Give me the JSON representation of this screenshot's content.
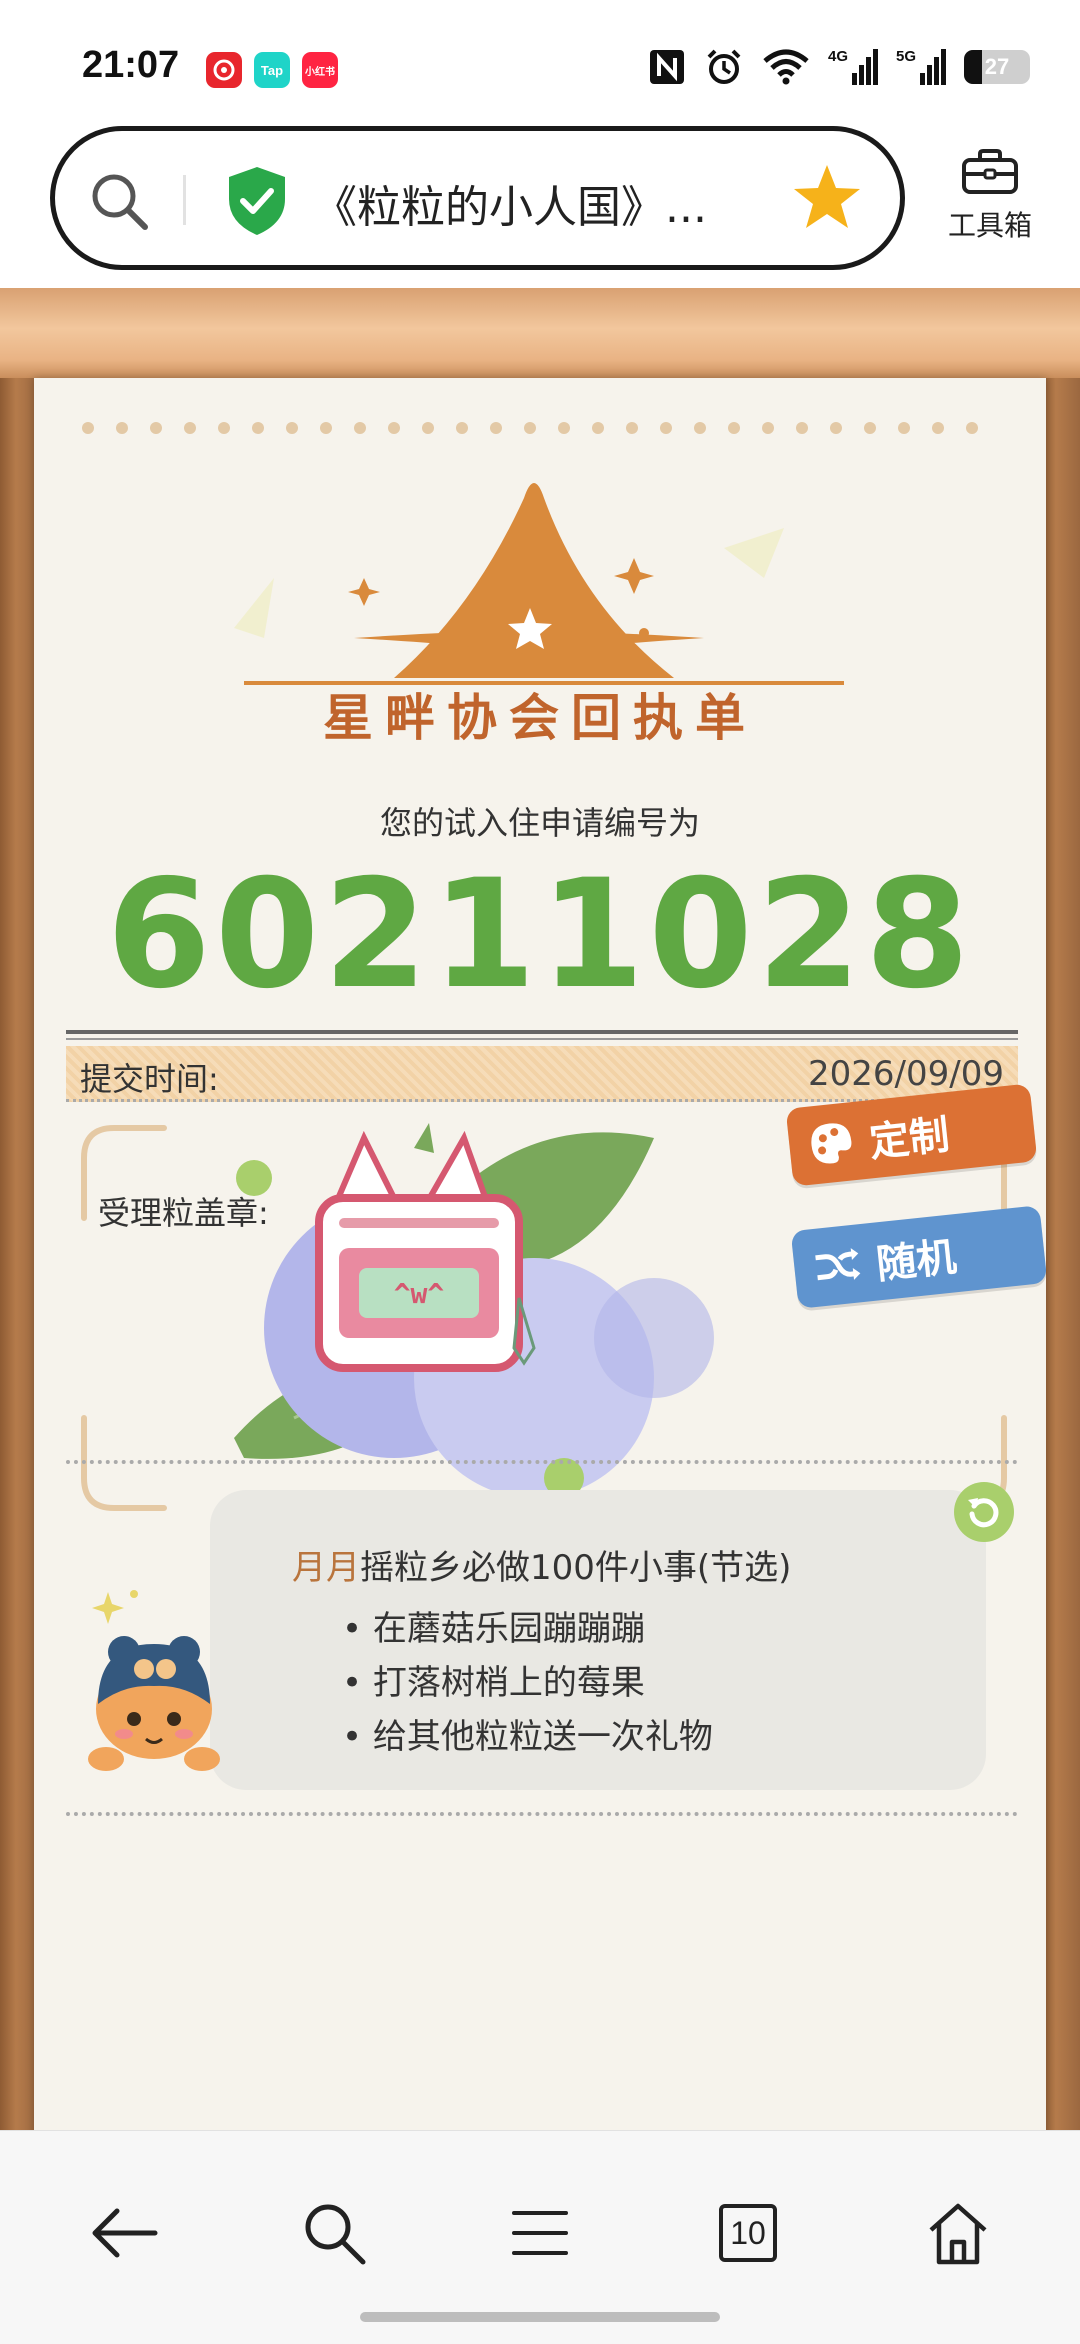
{
  "status_bar": {
    "time": "21:07",
    "apps": [
      {
        "name": "app-icon-red",
        "label": "",
        "color": "#e8262d"
      },
      {
        "name": "tap-icon",
        "label": "Tap",
        "color": "#1fd4c8"
      },
      {
        "name": "xiaohongshu-icon",
        "label": "小红书",
        "color": "#ff2442"
      }
    ],
    "network_4g": "4G",
    "network_5g": "5G",
    "battery_level": "27"
  },
  "address_bar": {
    "title": "《粒粒的小人国》...",
    "secure": true,
    "bookmarked": true
  },
  "toolbox": {
    "label": "工具箱"
  },
  "receipt": {
    "logo_title": "星畔协会回执单",
    "subtitle": "您的试入住申请编号为",
    "application_number": "60211028",
    "submit_label": "提交时间:",
    "submit_date": "2026/09/09",
    "stamp_label": "受理粒盖章:",
    "stamp_face": "^w^",
    "btn_custom": "定制",
    "btn_random": "随机"
  },
  "todo": {
    "author": "月月",
    "title_rest": "摇粒乡必做100件小事(节选)",
    "items": [
      "在蘑菇乐园蹦蹦蹦",
      "打落树梢上的莓果",
      "给其他粒粒送一次礼物"
    ]
  },
  "bottom_nav": {
    "tabs_count": "10"
  },
  "colors": {
    "accent_green": "#5fa843",
    "accent_orange": "#dc7134",
    "accent_blue": "#5f94cf",
    "logo_orange": "#c0642c",
    "paper": "#f6f3ec"
  }
}
